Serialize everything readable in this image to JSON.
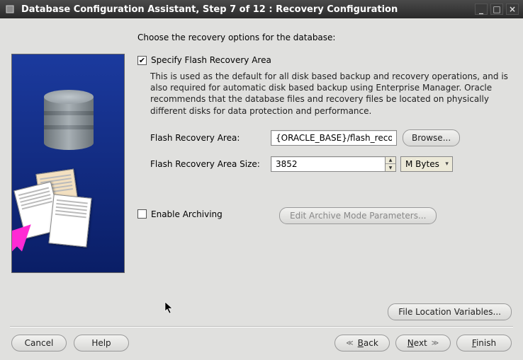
{
  "window": {
    "title": "Database Configuration Assistant, Step 7 of 12 : Recovery Configuration"
  },
  "heading": "Choose the recovery options for the database:",
  "specify": {
    "checked": true,
    "label": "Specify Flash Recovery Area",
    "description": "This is used as the default for all disk based backup and recovery operations, and is also required for automatic disk based backup using Enterprise Manager. Oracle recommends that the database files and recovery files be located on physically different disks for data protection and performance."
  },
  "fields": {
    "fra_label": "Flash Recovery Area:",
    "fra_value": "{ORACLE_BASE}/flash_recovery_",
    "browse_label": "Browse...",
    "fra_size_label": "Flash Recovery Area Size:",
    "fra_size_value": "3852",
    "unit_selected": "M Bytes"
  },
  "archive": {
    "checked": false,
    "label": "Enable Archiving",
    "edit_button": "Edit Archive Mode Parameters..."
  },
  "file_loc_button": "File Location Variables...",
  "buttons": {
    "cancel": "Cancel",
    "help": "Help",
    "back": "Back",
    "next": "Next",
    "finish": "Finish"
  }
}
